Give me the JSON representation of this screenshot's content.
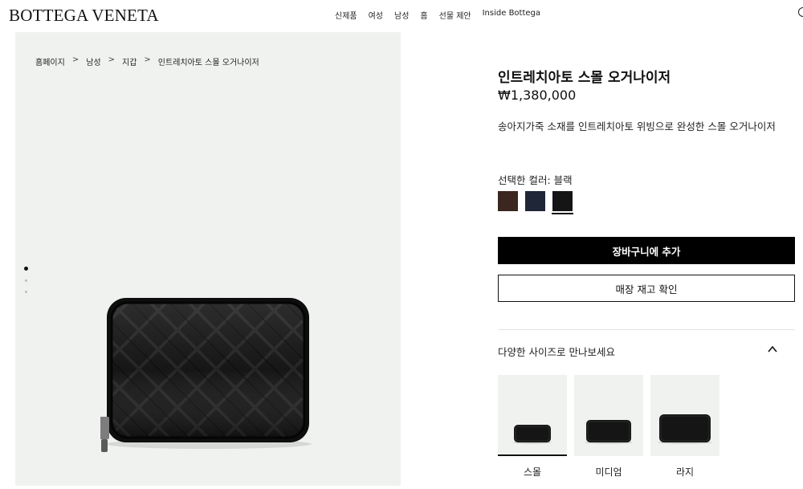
{
  "header": {
    "logo": "BOTTEGA VENETA",
    "nav": [
      "신제품",
      "여성",
      "남성",
      "홈",
      "선물 제안",
      "Inside Bottega"
    ]
  },
  "breadcrumb": [
    "홈페이지",
    "남성",
    "지갑",
    "인트레치아토 스몰 오거나이저"
  ],
  "breadcrumb_separator": ">",
  "gallery": {
    "image_count": 3,
    "active_index": 0
  },
  "product": {
    "title": "인트레치아토 스몰 오거나이저",
    "price": "₩1,380,000",
    "description": "송아지가죽 소재를 인트레치아토 위빙으로 완성한 스몰 오거나이저",
    "color_label": "선택한 컬러: 블랙",
    "colors": [
      {
        "name": "brown",
        "hex": "#3b2620"
      },
      {
        "name": "navy",
        "hex": "#1f2638"
      },
      {
        "name": "black",
        "hex": "#151515",
        "selected": true
      }
    ],
    "add_to_cart": "장바구니에 추가",
    "check_stock": "매장 재고 확인",
    "sizes_title": "다양한 사이즈로 만나보세요",
    "sizes": [
      {
        "label": "스몰",
        "selected": true
      },
      {
        "label": "미디엄",
        "selected": false
      },
      {
        "label": "라지",
        "selected": false
      }
    ]
  }
}
